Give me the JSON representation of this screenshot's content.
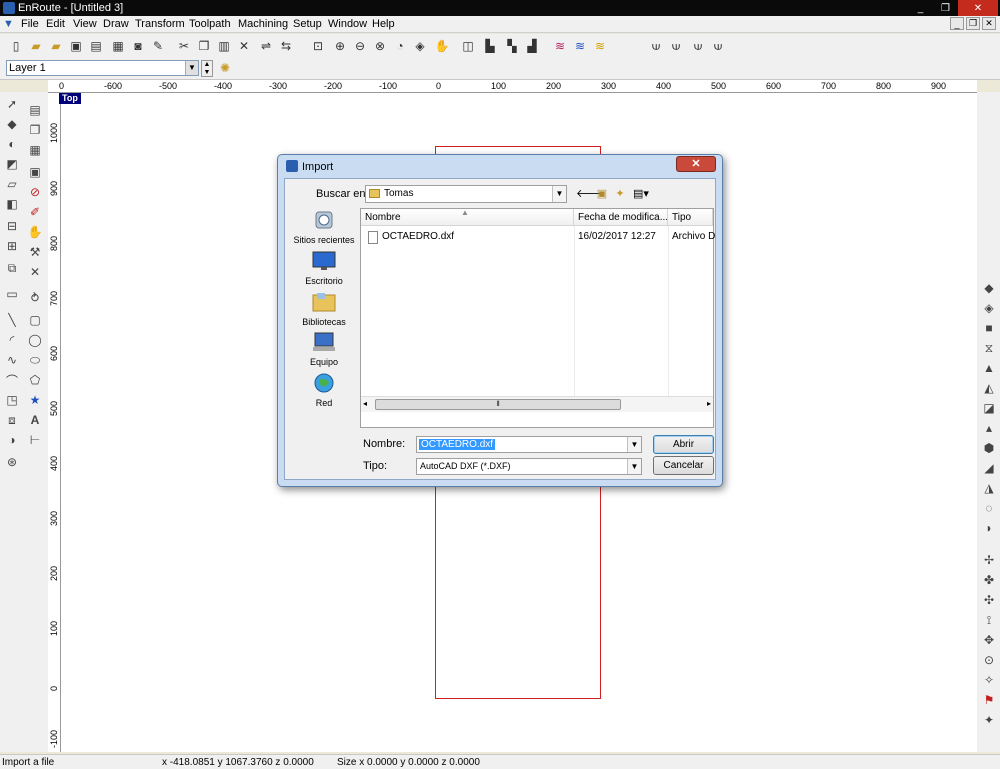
{
  "window": {
    "title": "EnRoute - [Untitled 3]",
    "min": "_",
    "max": "❐",
    "close": "✕"
  },
  "menu": [
    "File",
    "Edit",
    "View",
    "Draw",
    "Transform",
    "Toolpath",
    "Machining",
    "Setup",
    "Window",
    "Help"
  ],
  "mdi_buttons": [
    "_",
    "❐",
    "✕"
  ],
  "layer": {
    "value": "Layer 1"
  },
  "ruler": {
    "h_ticks": [
      "-600",
      "-500",
      "-400",
      "-300",
      "-200",
      "-100",
      "0",
      "100",
      "200",
      "300",
      "400",
      "500",
      "600",
      "700",
      "800",
      "900"
    ],
    "v_ticks": [
      "1000",
      "900",
      "800",
      "700",
      "600",
      "500",
      "400",
      "300",
      "200",
      "100",
      "0",
      "-100"
    ]
  },
  "view_label": "Top",
  "status": {
    "hint": "Import a file",
    "coords": "x -418.0851 y 1067.3760 z 0.0000",
    "size": "Size x 0.0000 y 0.0000 z 0.0000"
  },
  "dialog": {
    "title": "Import",
    "close": "✕",
    "look_in_label": "Buscar en:",
    "look_in_value": "Tomas",
    "places": [
      "Sitios recientes",
      "Escritorio",
      "Bibliotecas",
      "Equipo",
      "Red"
    ],
    "columns": [
      "Nombre",
      "Fecha de modifica...",
      "Tipo"
    ],
    "files": [
      {
        "name": "OCTAEDRO.dxf",
        "date": "16/02/2017 12:27",
        "type": "Archivo D"
      }
    ],
    "filename_label": "Nombre:",
    "filename_value": "OCTAEDRO.dxf",
    "filetype_label": "Tipo:",
    "filetype_value": "AutoCAD DXF (*.DXF)",
    "open_button": "Abrir",
    "cancel_button": "Cancelar"
  }
}
